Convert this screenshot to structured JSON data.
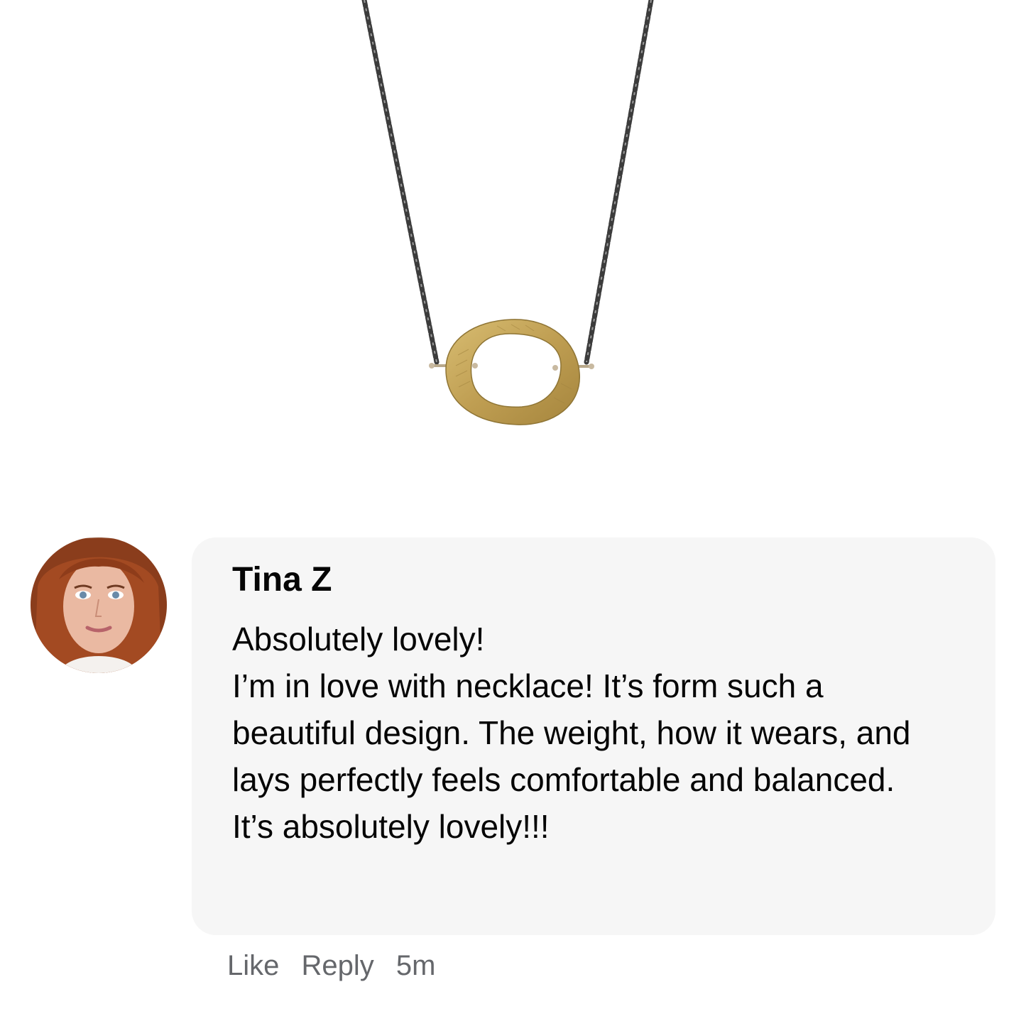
{
  "comment": {
    "author": "Tina Z",
    "lines": [
      "Absolutely lovely!",
      "I’m in love with necklace! It’s form such a",
      "beautiful design. The weight, how it wears, and",
      "lays perfectly feels comfortable and balanced.",
      "It’s absolutely lovely!!!"
    ],
    "actions": {
      "like": "Like",
      "reply": "Reply",
      "time": "5m"
    }
  },
  "colors": {
    "bubble": "#f6f6f6",
    "text": "#050505",
    "meta": "#65676b",
    "gold": "#c2a052"
  }
}
